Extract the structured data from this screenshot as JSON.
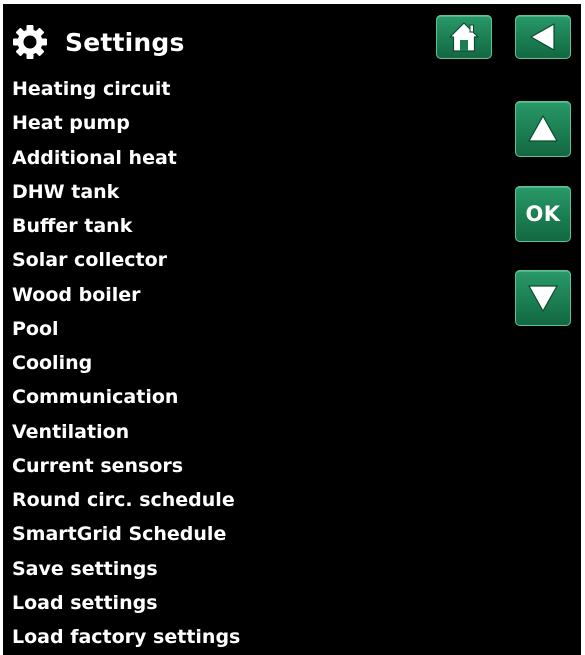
{
  "header": {
    "title": "Settings",
    "icon": "gear-icon"
  },
  "nav": {
    "home_icon": "home-icon",
    "back_icon": "back-arrow-icon",
    "up_icon": "arrow-up-icon",
    "ok_label": "OK",
    "down_icon": "arrow-down-icon"
  },
  "menu": {
    "items": [
      {
        "label": "Heating circuit"
      },
      {
        "label": "Heat pump"
      },
      {
        "label": "Additional heat"
      },
      {
        "label": "DHW tank"
      },
      {
        "label": "Buffer tank"
      },
      {
        "label": "Solar collector"
      },
      {
        "label": "Wood boiler"
      },
      {
        "label": "Pool"
      },
      {
        "label": "Cooling"
      },
      {
        "label": "Communication"
      },
      {
        "label": "Ventilation"
      },
      {
        "label": "Current sensors"
      },
      {
        "label": "Round circ. schedule"
      },
      {
        "label": "SmartGrid Schedule"
      },
      {
        "label": "Save settings"
      },
      {
        "label": "Load settings"
      },
      {
        "label": "Load factory settings"
      }
    ]
  },
  "colors": {
    "background": "#000000",
    "text": "#ffffff",
    "button_green": "#1b7e52",
    "button_border": "#5fc296"
  }
}
